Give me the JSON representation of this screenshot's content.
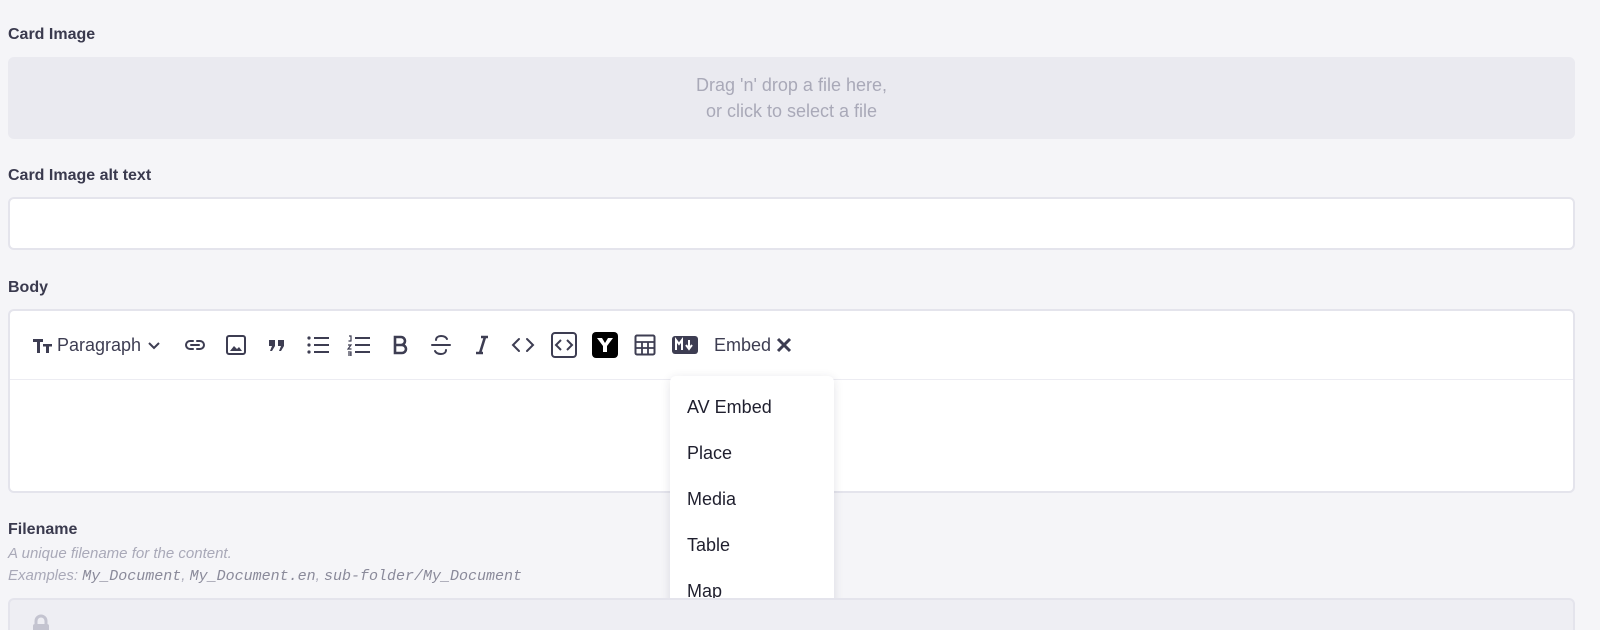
{
  "card_image": {
    "label": "Card Image",
    "drop_line1": "Drag 'n' drop a file here,",
    "drop_line2": "or click to select a file"
  },
  "card_image_alt": {
    "label": "Card Image alt text",
    "value": ""
  },
  "body": {
    "label": "Body",
    "toolbar": {
      "paragraph_label": "Paragraph",
      "embed_label": "Embed",
      "icons": [
        "text-size-icon",
        "chevron-down-icon",
        "link-icon",
        "image-icon",
        "quote-icon",
        "bullet-list-icon",
        "numbered-list-icon",
        "bold-icon",
        "strikethrough-icon",
        "italic-icon",
        "code-icon",
        "code-block-icon",
        "y-brand-icon",
        "table-icon",
        "markdown-icon",
        "close-icon"
      ]
    },
    "embed_menu": [
      "AV Embed",
      "Place",
      "Media",
      "Table",
      "Map"
    ]
  },
  "filename": {
    "label": "Filename",
    "hint": "A unique filename for the content.",
    "examples_prefix": "Examples: ",
    "example1": "My_Document",
    "sep1": ", ",
    "example2": "My_Document.en",
    "sep2": ", ",
    "example3": "sub-folder/My_Document"
  },
  "colors": {
    "background": "#f5f5f8",
    "label": "#3a3a4e",
    "muted": "#a9a9b8",
    "icon": "#3d3d52"
  }
}
